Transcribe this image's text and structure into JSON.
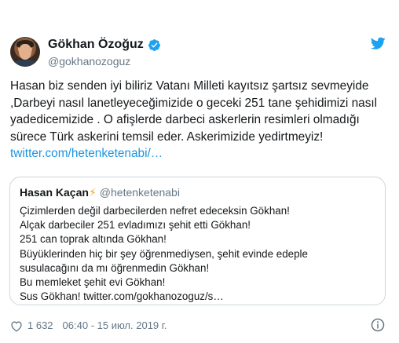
{
  "author": {
    "name": "Gökhan Özoğuz",
    "handle": "@gokhanozoguz"
  },
  "tweet": {
    "text": "Hasan biz senden iyi biliriz Vatanı Milleti kayıtsız şartsız sevmeyide ,Darbeyi nasıl lanetleyeceğimizide o geceki 251 tane şehidimizi nasıl yadedicemizide . O afişlerde darbeci askerlerin resimleri olmadığı sürece Türk askerini temsil eder. Askerimizide yedirtmeyiz! ",
    "link": "twitter.com/hetenketenabi/…"
  },
  "quoted": {
    "name": "Hasan Kaçan",
    "emoji": "⚡",
    "handle": "@hetenketenabi",
    "lines": [
      "Çizimlerden değil darbecilerden nefret edeceksin Gökhan!",
      "Alçak darbeciler 251 evladımızı şehit etti Gökhan!",
      "251 can toprak altında Gökhan!",
      "Büyüklerinden hiç bir şey öğrenmediysen, şehit evinde edeple",
      "susulacağını da mı öğrenmedin Gökhan!",
      "Bu memleket şehit evi Gökhan!",
      "Sus Gökhan! twitter.com/gokhanozoguz/s…"
    ]
  },
  "footer": {
    "likes": "1 632",
    "timestamp": "06:40 - 15 июл. 2019 г."
  },
  "colors": {
    "accent": "#1da1f2",
    "link": "#1b95e0",
    "muted": "#657786"
  },
  "icons": {
    "verified": "verified-badge-icon",
    "bird": "twitter-bird-icon",
    "heart": "heart-icon",
    "info": "info-icon"
  }
}
